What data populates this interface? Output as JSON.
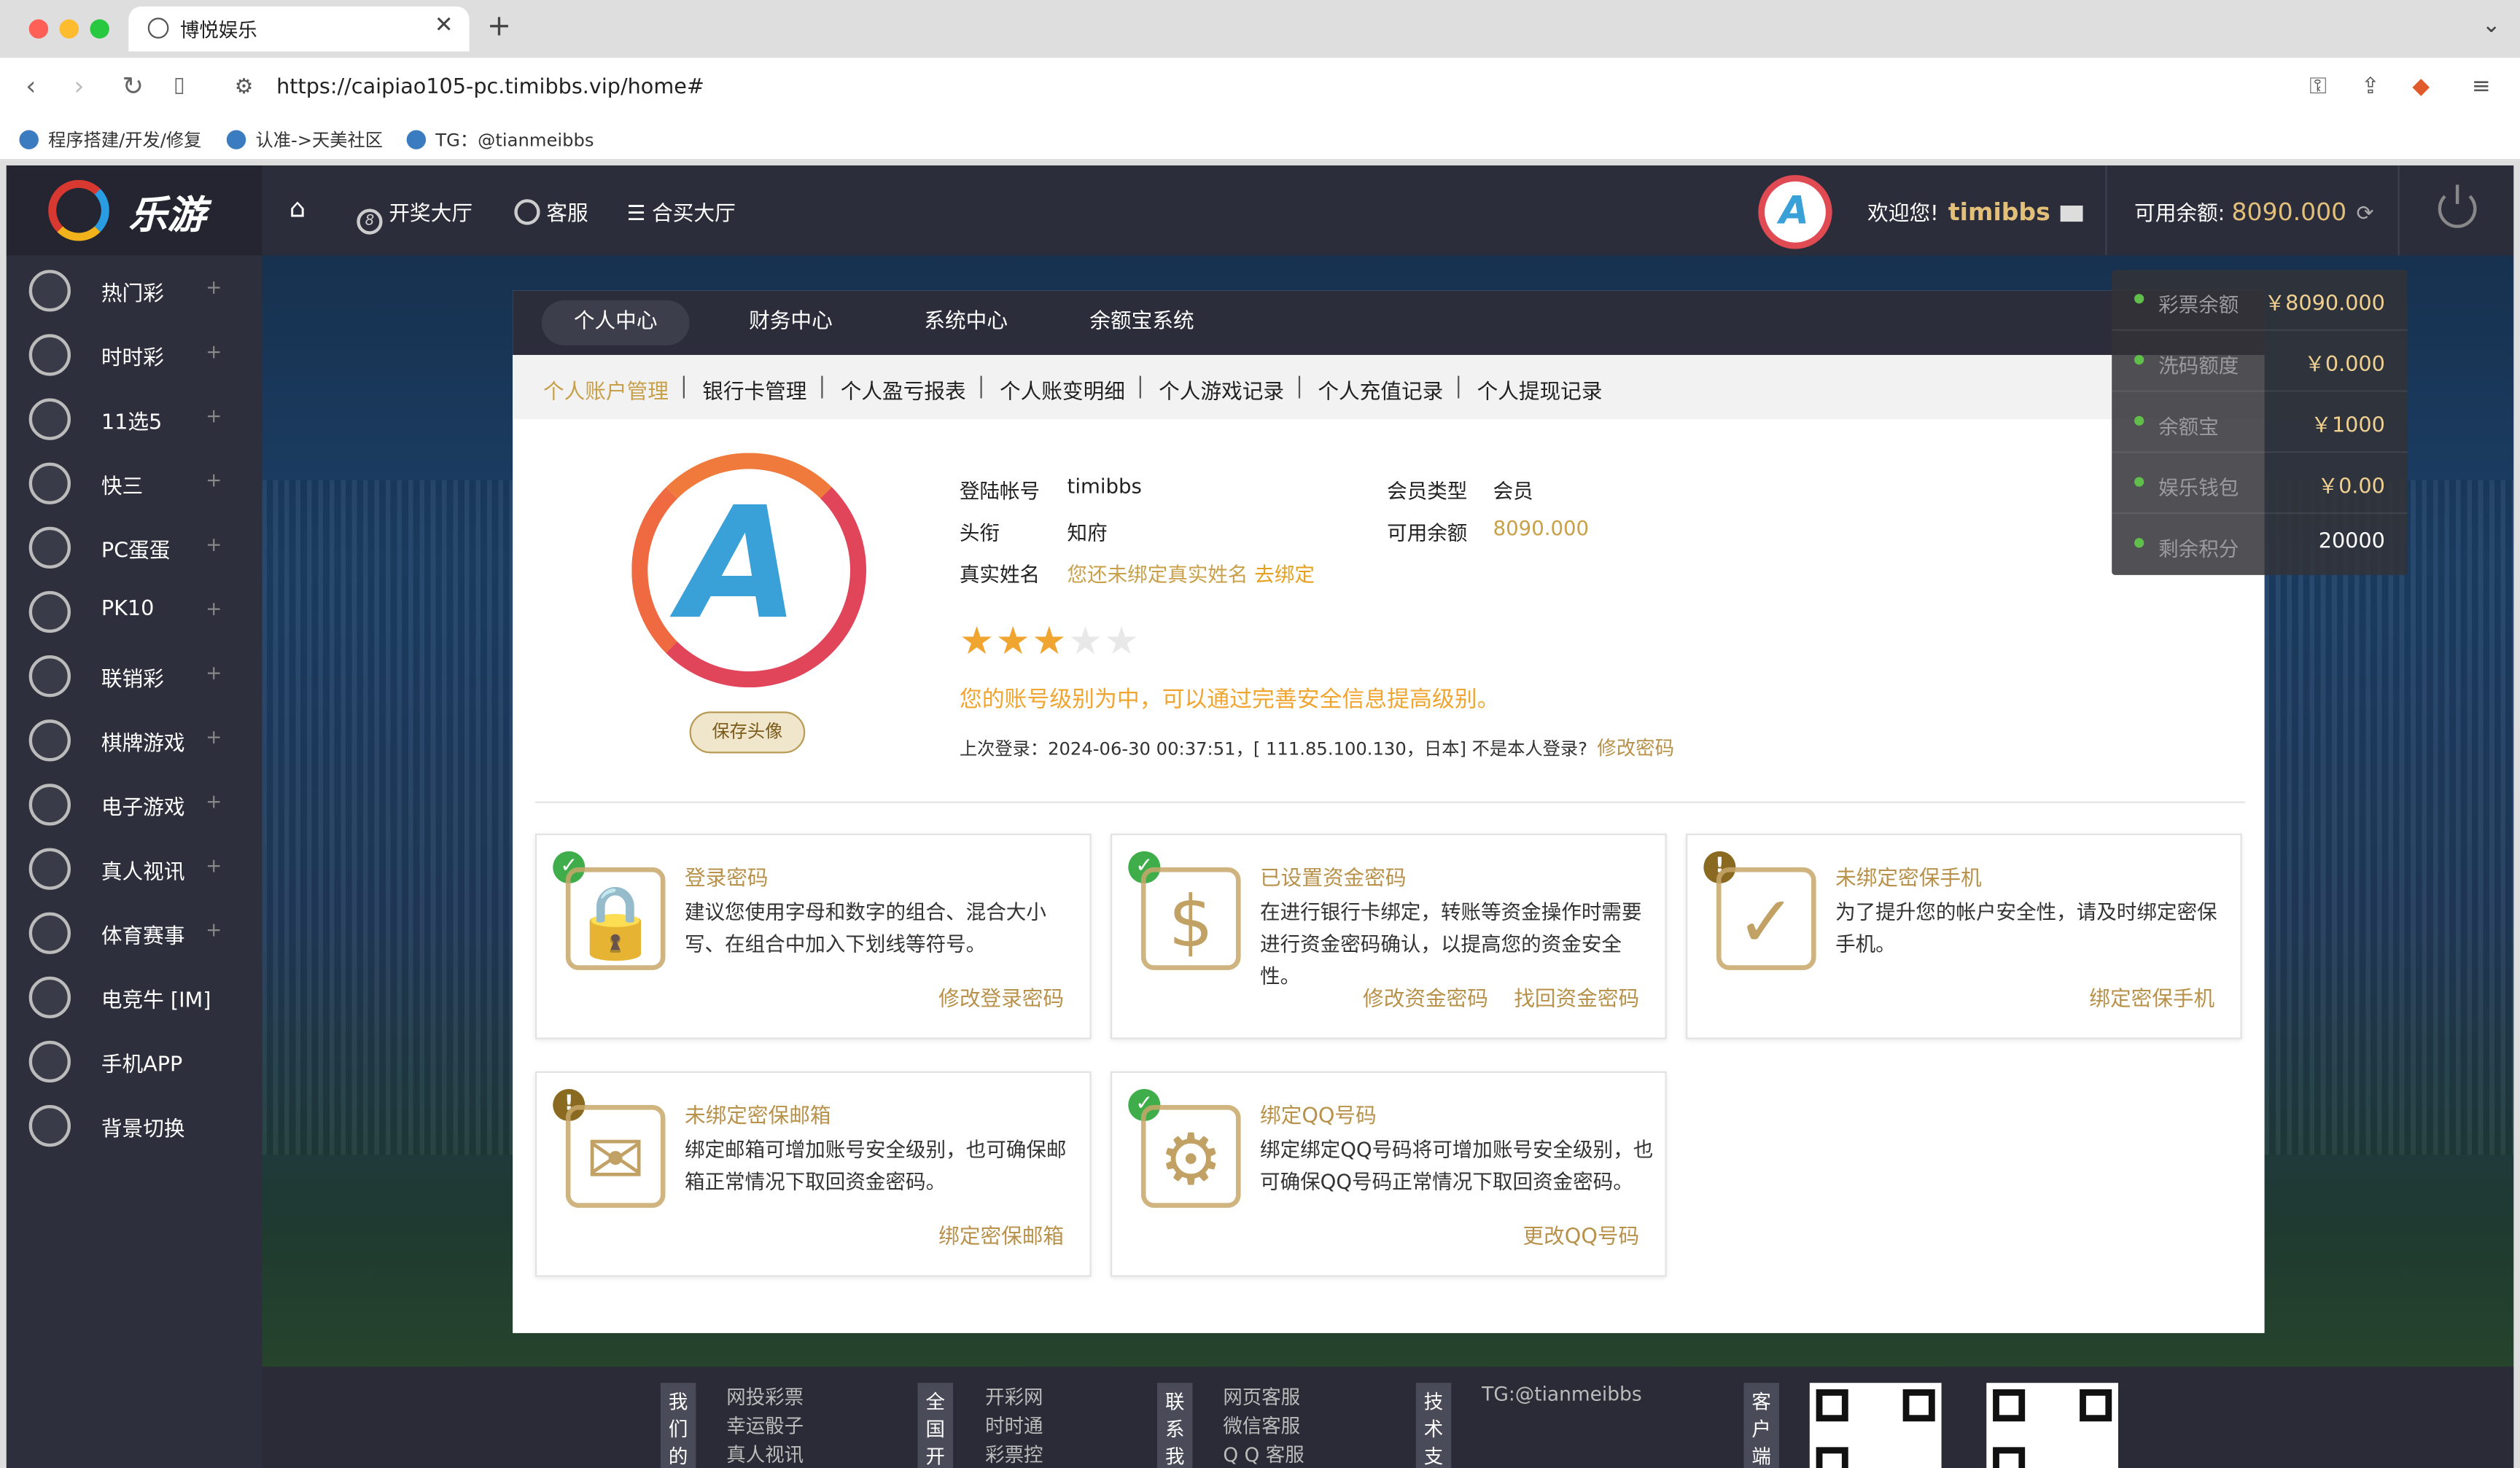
{
  "browser": {
    "tab_title": "博悦娱乐",
    "url": "https://caipiao105-pc.timibbs.vip/home#",
    "bookmarks": [
      "程序搭建/开发/修复",
      "认准->天美社区",
      "TG：@tianmeibbs"
    ]
  },
  "header": {
    "logo_text": "乐游",
    "nav": [
      "开奖大厅",
      "客服",
      "合买大厅"
    ],
    "welcome_label": "欢迎您!",
    "username": "timibbs",
    "balance_label": "可用余额:",
    "balance_value": "8090.000"
  },
  "sidebar": {
    "items": [
      {
        "label": "热门彩",
        "plus": "+"
      },
      {
        "label": "时时彩",
        "plus": "+"
      },
      {
        "label": "11选5",
        "plus": "+"
      },
      {
        "label": "快三",
        "plus": "+"
      },
      {
        "label": "PC蛋蛋",
        "plus": "+"
      },
      {
        "label": "PK10",
        "plus": "+"
      },
      {
        "label": "联销彩",
        "plus": "+"
      },
      {
        "label": "棋牌游戏",
        "plus": "+"
      },
      {
        "label": "电子游戏",
        "plus": "+"
      },
      {
        "label": "真人视讯",
        "plus": "+"
      },
      {
        "label": "体育赛事",
        "plus": "+"
      },
      {
        "label": "电竞牛  [IM]",
        "plus": ""
      },
      {
        "label": "手机APP",
        "plus": ""
      },
      {
        "label": "背景切换",
        "plus": ""
      }
    ]
  },
  "main_tabs": [
    "个人中心",
    "财务中心",
    "系统中心",
    "余额宝系统"
  ],
  "sub_nav": [
    "个人账户管理",
    "银行卡管理",
    "个人盈亏报表",
    "个人账变明细",
    "个人游戏记录",
    "个人充值记录",
    "个人提现记录"
  ],
  "profile": {
    "save_avatar": "保存头像",
    "login_account_label": "登陆帐号",
    "login_account": "timibbs",
    "member_type_label": "会员类型",
    "member_type": "会员",
    "title_label": "头衔",
    "title": "知府",
    "available_label": "可用余额",
    "available": "8090.000",
    "realname_label": "真实姓名",
    "realname_msg": "您还未绑定真实姓名",
    "realname_link": "去绑定",
    "star_rating": 3,
    "star_max": 5,
    "level_msg": "您的账号级别为中，可以通过完善安全信息提高级别。",
    "last_login": "上次登录：2024-06-30 00:37:51，[ 111.85.100.130，日本] 不是本人登录?",
    "change_pwd_link": "修改密码"
  },
  "cards": [
    {
      "title": "登录密码",
      "status": "ok",
      "desc": "建议您使用字母和数字的组合、混合大小写、在组合中加入下划线等符号。",
      "links": [
        "修改登录密码"
      ],
      "icon": "lock-icon"
    },
    {
      "title": "已设置资金密码",
      "status": "ok",
      "desc": "在进行银行卡绑定，转账等资金操作时需要进行资金密码确认，以提高您的资金安全性。",
      "links": [
        "修改资金密码",
        "找回资金密码"
      ],
      "icon": "money-lock-icon"
    },
    {
      "title": "未绑定密保手机",
      "status": "warn",
      "desc": "为了提升您的帐户安全性，请及时绑定密保手机。",
      "links": [
        "绑定密保手机"
      ],
      "icon": "shield-icon"
    },
    {
      "title": "未绑定密保邮箱",
      "status": "warn",
      "desc": "绑定邮箱可增加账号安全级别，也可确保邮箱正常情况下取回资金密码。",
      "links": [
        "绑定密保邮箱"
      ],
      "icon": "mail-icon"
    },
    {
      "title": "绑定QQ号码",
      "status": "ok",
      "desc": "绑定绑定QQ号码将可增加账号安全级别，也可确保QQ号码正常情况下取回资金密码。",
      "links": [
        "更改QQ号码"
      ],
      "icon": "user-gear-icon"
    }
  ],
  "balance_dropdown": [
    {
      "label": "彩票余额",
      "value": "￥8090.000"
    },
    {
      "label": "洗码额度",
      "value": "￥0.000"
    },
    {
      "label": "余额宝",
      "value": "￥1000"
    },
    {
      "label": "娱乐钱包",
      "value": "￥0.00"
    },
    {
      "label": "剩余积分",
      "value": "20000"
    }
  ],
  "footer": {
    "col1_head": "我们的",
    "col1": [
      "网投彩票",
      "幸运骰子",
      "真人视讯"
    ],
    "col2_head": "全国开",
    "col2": [
      "开彩网",
      "时时通",
      "彩票控"
    ],
    "col3_head": "联系我",
    "col3": [
      "网页客服",
      "微信客服",
      "Q Q 客服"
    ],
    "col4_head": "技术支",
    "col4": [
      "TG:@tianmeibbs"
    ],
    "col5_head": "客户端"
  },
  "colors": {
    "accent": "#c8a04a",
    "star": "#f0a531",
    "ok": "#3fae4a"
  }
}
